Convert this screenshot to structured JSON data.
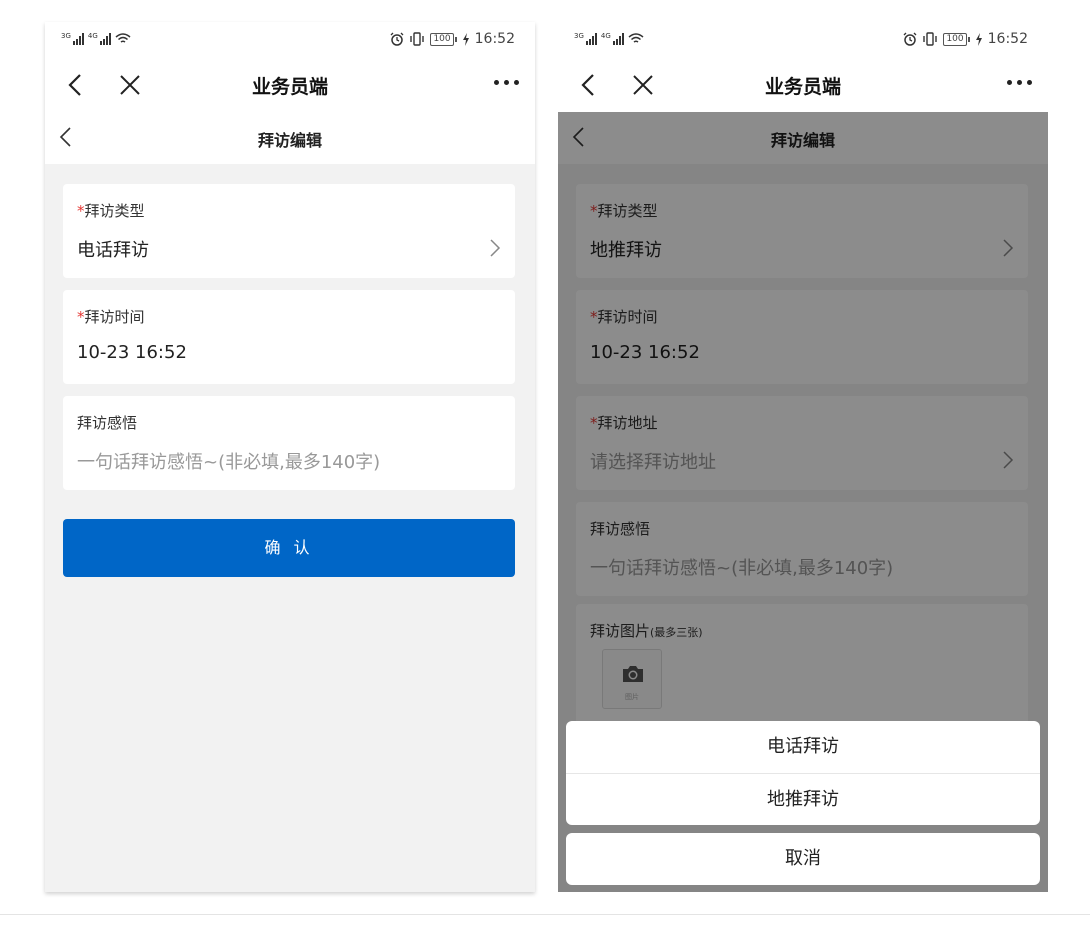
{
  "status_bar": {
    "signal_1": "3G",
    "signal_2": "4G",
    "battery": "100",
    "time": "16:52"
  },
  "app_bar": {
    "title": "业务员端"
  },
  "left_screen": {
    "page_title": "拜访编辑",
    "fields": {
      "visit_type": {
        "label": "拜访类型",
        "value": "电话拜访"
      },
      "visit_time": {
        "label": "拜访时间",
        "value": "10-23 16:52"
      },
      "visit_thoughts": {
        "label": "拜访感悟",
        "placeholder": "一句话拜访感悟~(非必填,最多140字)"
      }
    },
    "confirm_label": "确 认"
  },
  "right_screen": {
    "page_title": "拜访编辑",
    "fields": {
      "visit_type": {
        "label": "拜访类型",
        "value": "地推拜访"
      },
      "visit_time": {
        "label": "拜访时间",
        "value": "10-23 16:52"
      },
      "visit_address": {
        "label": "拜访地址",
        "placeholder": "请选择拜访地址"
      },
      "visit_thoughts": {
        "label": "拜访感悟",
        "placeholder": "一句话拜访感悟~(非必填,最多140字)"
      },
      "visit_photos": {
        "label": "拜访图片",
        "hint": "(最多三张)",
        "slot_label": "图片"
      }
    },
    "action_sheet": {
      "options": [
        "电话拜访",
        "地推拜访"
      ],
      "cancel_label": "取消"
    }
  },
  "colors": {
    "primary_blue": "#0066c7",
    "required_star": "#e53935",
    "page_background": "#f2f2f2",
    "overlay_dim": "rgba(0,0,0,0.45)"
  },
  "icons": [
    "back-arrow-icon",
    "close-icon",
    "more-icon",
    "chevron-right-icon",
    "camera-icon",
    "alarm-icon",
    "vibrate-icon",
    "wifi-icon",
    "battery-icon",
    "charging-icon",
    "signal-icon"
  ]
}
